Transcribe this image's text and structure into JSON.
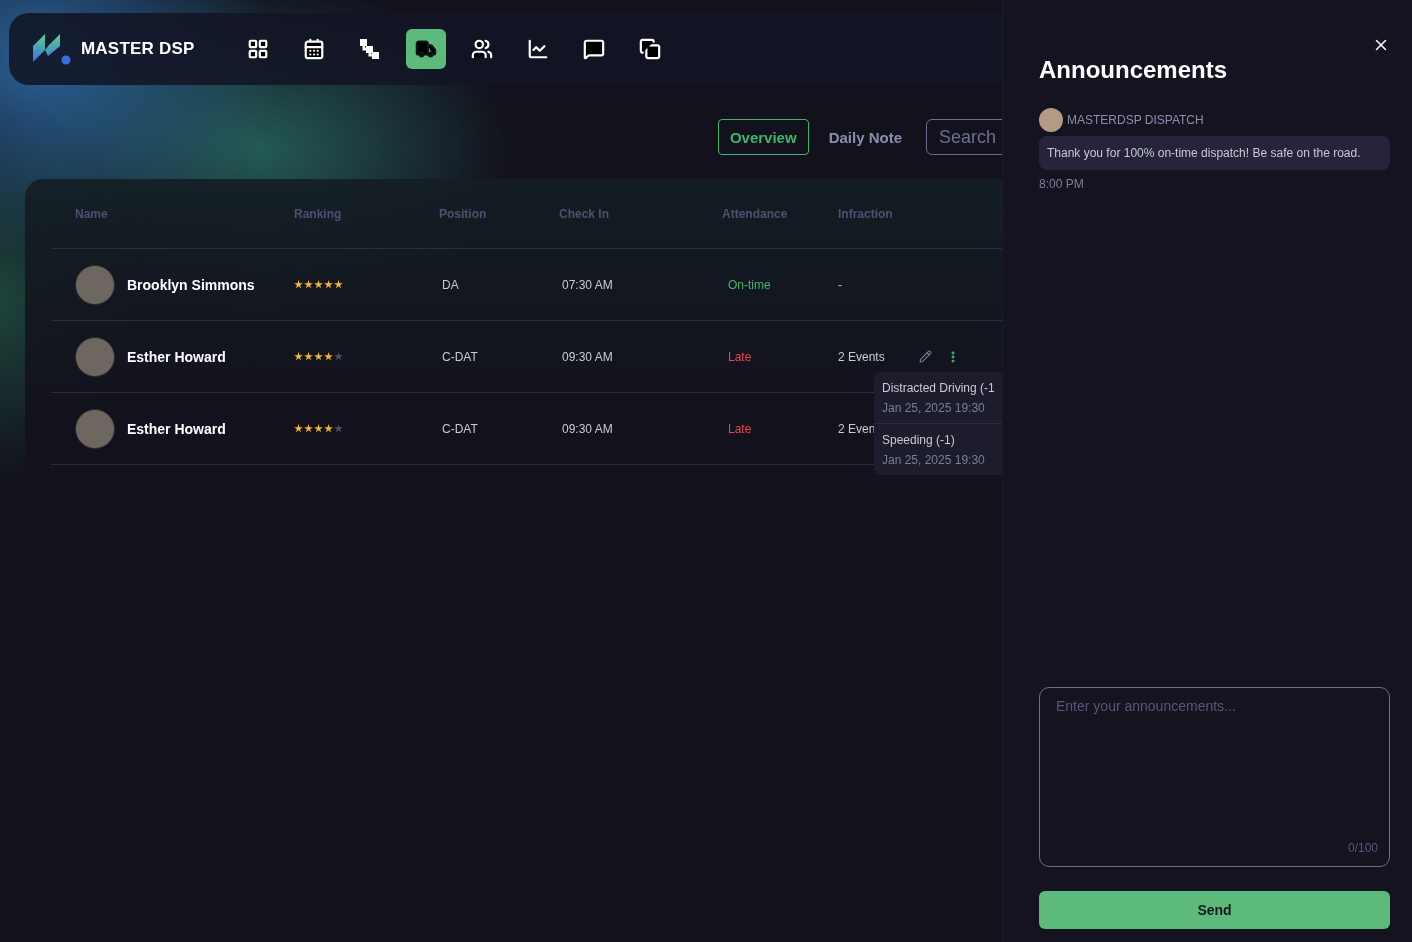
{
  "brand": {
    "name": "MASTER DSP"
  },
  "nav": {
    "items": [
      {
        "selected": false
      },
      {
        "selected": false
      },
      {
        "selected": false
      },
      {
        "selected": true
      },
      {
        "selected": false
      },
      {
        "selected": false
      },
      {
        "selected": false
      },
      {
        "selected": false
      }
    ]
  },
  "tabs": [
    {
      "label": "Overview",
      "selected": true
    },
    {
      "label": "Daily Note",
      "selected": false
    }
  ],
  "search": {
    "placeholder": "Search"
  },
  "table": {
    "columns": [
      "Name",
      "Ranking",
      "Position",
      "Check In",
      "Attendance",
      "Infraction"
    ],
    "rows": [
      {
        "name": "Brooklyn Simmons",
        "stars": 5,
        "position": "DA",
        "check_in": "07:30 AM",
        "attendance": "On-time",
        "color": "#3fb56a",
        "infraction": "-",
        "show_actions": false
      },
      {
        "name": "Esther Howard",
        "stars": 4,
        "position": "C-DAT",
        "check_in": "09:30 AM",
        "attendance": "Late",
        "color": "#e5484d",
        "infraction": "2 Events",
        "show_actions": true,
        "popover": [
          {
            "title": "Distracted Driving (-1",
            "time": "Jan 25, 2025 19:30"
          },
          {
            "title": "Speeding (-1)",
            "time": "Jan 25, 2025 19:30"
          }
        ]
      },
      {
        "name": "Esther Howard",
        "stars": 4,
        "position": "C-DAT",
        "check_in": "09:30 AM",
        "attendance": "Late",
        "color": "#e5484d",
        "infraction": "2 Even",
        "show_actions": false
      }
    ]
  },
  "panel": {
    "title": "Announcements",
    "messages": [
      {
        "sender": "MASTERDSP DISPATCH",
        "text": "Thank you for 100% on-time dispatch! Be safe on the road.",
        "time": "8:00 PM"
      }
    ],
    "composer": {
      "placeholder": "Enter your announcements...",
      "counter": "0/100"
    },
    "send": "Send"
  }
}
